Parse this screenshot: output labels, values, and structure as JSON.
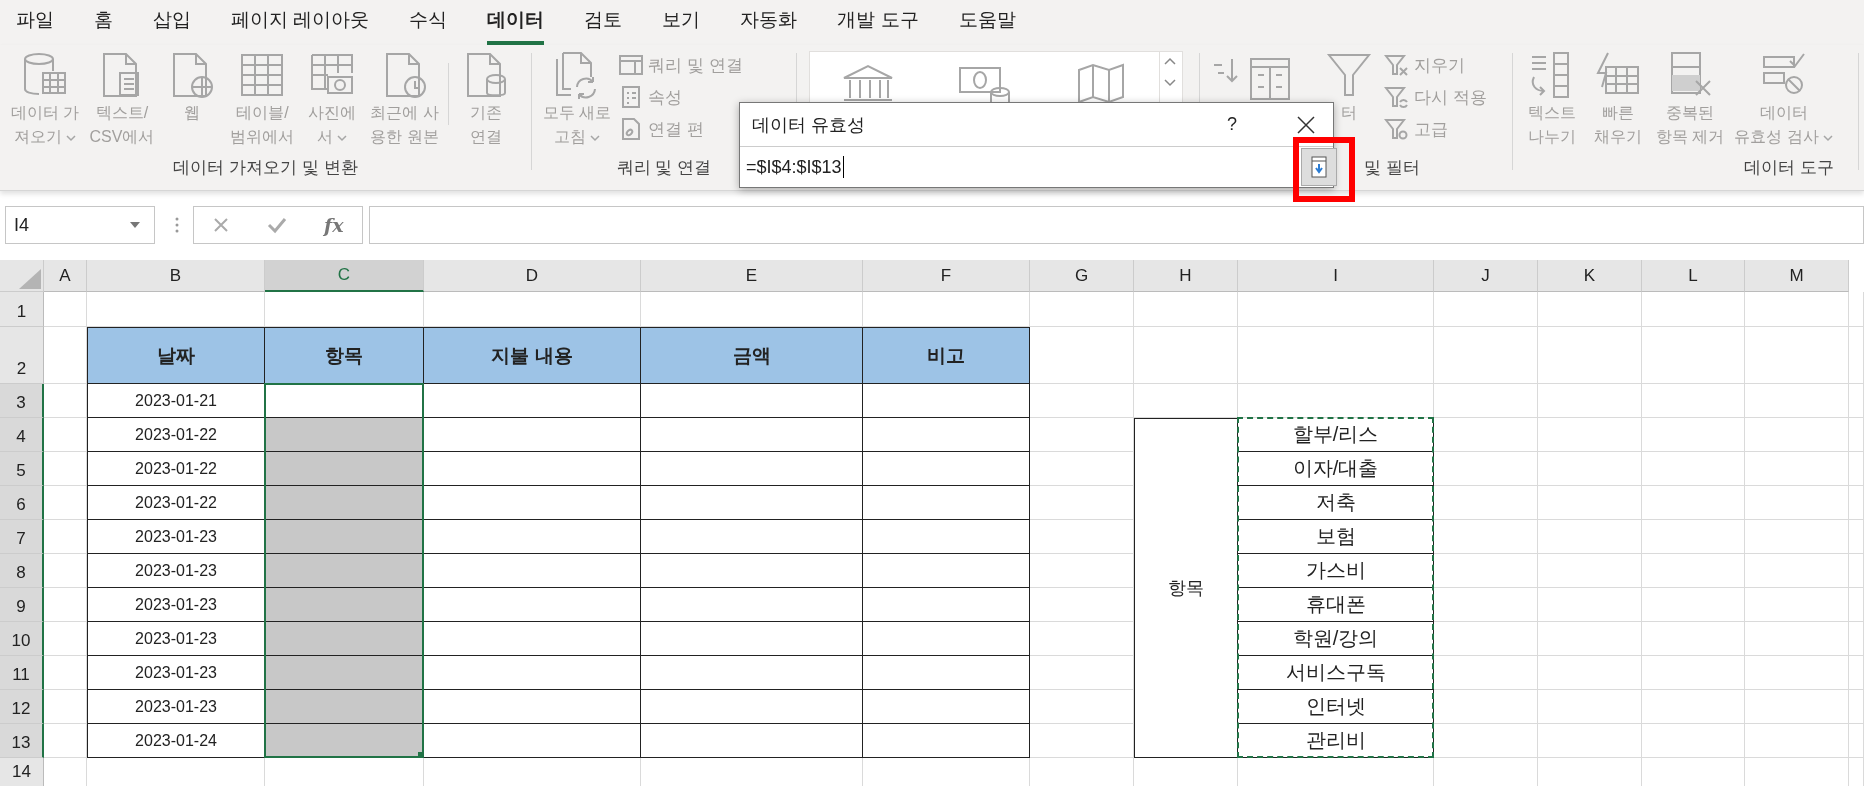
{
  "tabs": [
    {
      "label": "파일",
      "selected": false
    },
    {
      "label": "홈",
      "selected": false
    },
    {
      "label": "삽입",
      "selected": false
    },
    {
      "label": "페이지 레이아웃",
      "selected": false
    },
    {
      "label": "수식",
      "selected": false
    },
    {
      "label": "데이터",
      "selected": true
    },
    {
      "label": "검토",
      "selected": false
    },
    {
      "label": "보기",
      "selected": false
    },
    {
      "label": "자동화",
      "selected": false
    },
    {
      "label": "개발 도구",
      "selected": false
    },
    {
      "label": "도움말",
      "selected": false
    }
  ],
  "ribbon": {
    "groups": [
      {
        "kind": "commands",
        "label": "데이터 가져오기 및 변환",
        "commands": [
          {
            "kind": "large",
            "label": "데이터 가\n져오기",
            "dropdown": true,
            "disabled": true
          },
          {
            "kind": "large",
            "label": "텍스트/\nCSV에서",
            "dropdown": false,
            "disabled": true
          },
          {
            "kind": "large",
            "label": "웹",
            "dropdown": false,
            "disabled": true
          },
          {
            "kind": "large",
            "label": "테이블/\n범위에서",
            "dropdown": false,
            "disabled": true
          },
          {
            "kind": "large",
            "label": "사진에\n서",
            "dropdown": true,
            "disabled": true
          },
          {
            "kind": "large",
            "label": "최근에 사\n용한 원본",
            "dropdown": false,
            "disabled": true
          },
          {
            "kind": "separator"
          },
          {
            "kind": "large",
            "label": "기존\n연결",
            "dropdown": false,
            "disabled": true
          }
        ]
      },
      {
        "kind": "commands",
        "label": "쿼리 및 연결",
        "commands": [
          {
            "kind": "large",
            "label": "모두 새로\n고침",
            "dropdown": true,
            "disabled": true
          },
          {
            "kind": "small",
            "label": "쿼리 및 연결",
            "disabled": true
          },
          {
            "kind": "small",
            "label": "속성",
            "disabled": true
          },
          {
            "kind": "small",
            "label": "연결 편",
            "disabled": true
          }
        ]
      },
      {
        "kind": "gallery"
      },
      {
        "kind": "commands",
        "label": "및 필터",
        "commands": [
          {
            "kind": "icon",
            "disabled": true
          },
          {
            "kind": "icon",
            "disabled": true
          },
          {
            "kind": "large",
            "label": "터",
            "dropdown": false,
            "disabled": true
          },
          {
            "kind": "small",
            "label": "지우기",
            "disabled": true
          },
          {
            "kind": "small",
            "label": "다시 적용",
            "disabled": true
          },
          {
            "kind": "small",
            "label": "고급",
            "disabled": true
          }
        ]
      },
      {
        "kind": "commands",
        "label": "데이터 도구",
        "commands": [
          {
            "kind": "large",
            "label": "텍스트\n나누기",
            "dropdown": false,
            "disabled": true
          },
          {
            "kind": "large",
            "label": "빠른\n채우기",
            "dropdown": false,
            "disabled": true
          },
          {
            "kind": "large",
            "label": "중복된\n항목 제거",
            "dropdown": false,
            "disabled": true
          },
          {
            "kind": "large",
            "label": "데이터\n유효성 검사",
            "dropdown": true,
            "disabled": true
          }
        ]
      }
    ]
  },
  "formula_bar": {
    "name_box": "I4",
    "function_label": "fx"
  },
  "sheet": {
    "columns": [
      {
        "label": "A",
        "selected": false
      },
      {
        "label": "B",
        "selected": false
      },
      {
        "label": "C",
        "selected": true
      },
      {
        "label": "D",
        "selected": false
      },
      {
        "label": "E",
        "selected": false
      },
      {
        "label": "F",
        "selected": false
      },
      {
        "label": "G",
        "selected": false
      },
      {
        "label": "H",
        "selected": false
      },
      {
        "label": "I",
        "selected": false
      },
      {
        "label": "J",
        "selected": false
      },
      {
        "label": "K",
        "selected": false
      },
      {
        "label": "L",
        "selected": false
      },
      {
        "label": "M",
        "selected": false
      }
    ],
    "rows": [
      {
        "label": "1",
        "selected": false
      },
      {
        "label": "2",
        "selected": false
      },
      {
        "label": "3",
        "selected": true
      },
      {
        "label": "4",
        "selected": true
      },
      {
        "label": "5",
        "selected": true
      },
      {
        "label": "6",
        "selected": true
      },
      {
        "label": "7",
        "selected": true
      },
      {
        "label": "8",
        "selected": true
      },
      {
        "label": "9",
        "selected": true
      },
      {
        "label": "10",
        "selected": true
      },
      {
        "label": "11",
        "selected": true
      },
      {
        "label": "12",
        "selected": true
      },
      {
        "label": "13",
        "selected": true
      },
      {
        "label": "14",
        "selected": false
      }
    ],
    "table": {
      "headers": [
        "날짜",
        "항목",
        "지불 내용",
        "금액",
        "비고"
      ],
      "rows": [
        {
          "date": "2023-01-21",
          "highlighted": false
        },
        {
          "date": "2023-01-22",
          "highlighted": true
        },
        {
          "date": "2023-01-22",
          "highlighted": true
        },
        {
          "date": "2023-01-22",
          "highlighted": true
        },
        {
          "date": "2023-01-23",
          "highlighted": true
        },
        {
          "date": "2023-01-23",
          "highlighted": true
        },
        {
          "date": "2023-01-23",
          "highlighted": true
        },
        {
          "date": "2023-01-23",
          "highlighted": true
        },
        {
          "date": "2023-01-23",
          "highlighted": true
        },
        {
          "date": "2023-01-23",
          "highlighted": true
        },
        {
          "date": "2023-01-24",
          "highlighted": true
        }
      ]
    },
    "list": {
      "label": "항목",
      "copy_marquee": true,
      "items": [
        "할부/리스",
        "이자/대출",
        "저축",
        "보험",
        "가스비",
        "휴대폰",
        "학원/강의",
        "서비스구독",
        "인터넷",
        "관리비"
      ]
    }
  },
  "dialog": {
    "title": "데이터 유효성",
    "help": "?",
    "value": "=$I$4:$I$13",
    "collapse_highlighted": true
  }
}
